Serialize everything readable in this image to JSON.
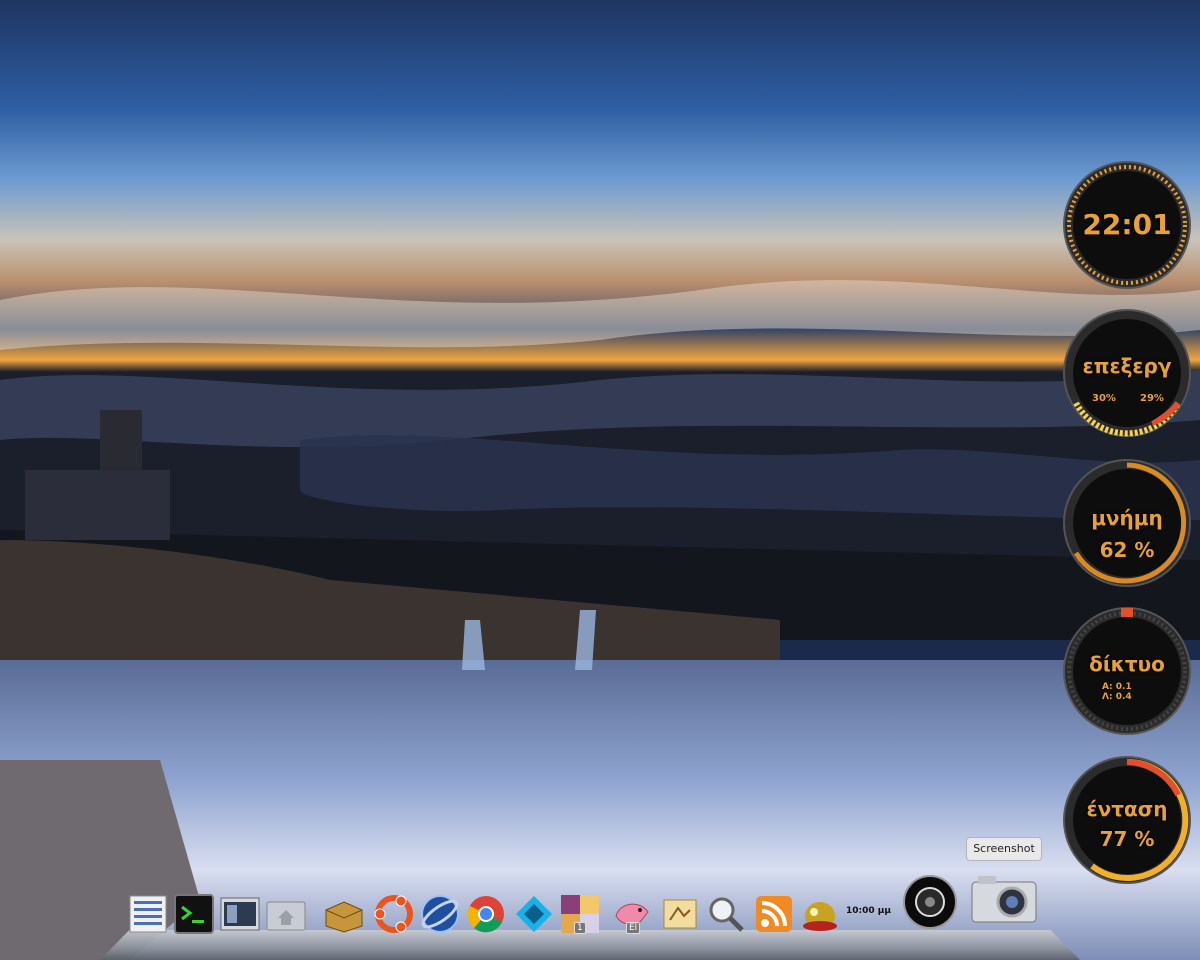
{
  "gauges": {
    "clock": {
      "time": "22:01"
    },
    "cpu": {
      "label": "επεξεργ",
      "core1": "30%",
      "core2": "29%",
      "level": 0.3
    },
    "memory": {
      "label": "μνήμη",
      "value": "62 %",
      "level": 0.62
    },
    "network": {
      "label": "δίκτυο",
      "down": "Α: 0.1",
      "up": "Λ: 0.4"
    },
    "volume": {
      "label": "ένταση",
      "value": "77 %",
      "level": 0.77
    }
  },
  "dock": {
    "items": [
      {
        "name": "system-monitor-icon"
      },
      {
        "name": "terminal-icon"
      },
      {
        "name": "window-manager-icon"
      },
      {
        "name": "home-folder-icon"
      },
      {
        "name": "archive-manager-icon"
      },
      {
        "name": "ubuntu-software-icon"
      },
      {
        "name": "web-browser-orb-icon"
      },
      {
        "name": "chrome-icon"
      },
      {
        "name": "kodi-icon"
      },
      {
        "name": "workspace-switcher-icon"
      },
      {
        "name": "input-language-icon"
      },
      {
        "name": "mail-stamp-icon"
      },
      {
        "name": "search-icon"
      },
      {
        "name": "rss-icon"
      },
      {
        "name": "audio-player-icon"
      },
      {
        "name": "power-button-icon"
      },
      {
        "name": "screenshot-camera-icon"
      }
    ],
    "workspace_number": "1",
    "language": "El",
    "clock": "10:00 μμ",
    "tooltip": "Screenshot"
  },
  "colors": {
    "accent": "#e8a13a",
    "gauge_bg": "#0d0d0d",
    "ring": "#2b2b2b"
  }
}
